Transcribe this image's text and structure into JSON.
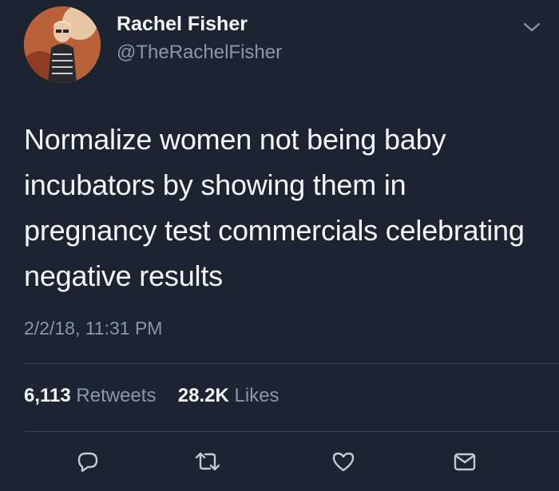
{
  "tweet": {
    "author": {
      "display_name": "Rachel Fisher",
      "handle": "@TheRachelFisher"
    },
    "text": "Normalize women not being baby incubators by showing them in pregnancy test commercials celebrating negative results",
    "timestamp": "2/2/18, 11:31 PM",
    "stats": {
      "retweets_count": "6,113",
      "retweets_label": "Retweets",
      "likes_count": "28.2K",
      "likes_label": "Likes"
    },
    "actions": {
      "reply_icon": "reply-icon",
      "retweet_icon": "retweet-icon",
      "like_icon": "heart-icon",
      "dm_icon": "envelope-icon"
    }
  },
  "theme": {
    "background": "#1c2331",
    "primary_text": "#f5f8fa",
    "secondary_text": "#8899a6",
    "divider": "#38444d"
  }
}
